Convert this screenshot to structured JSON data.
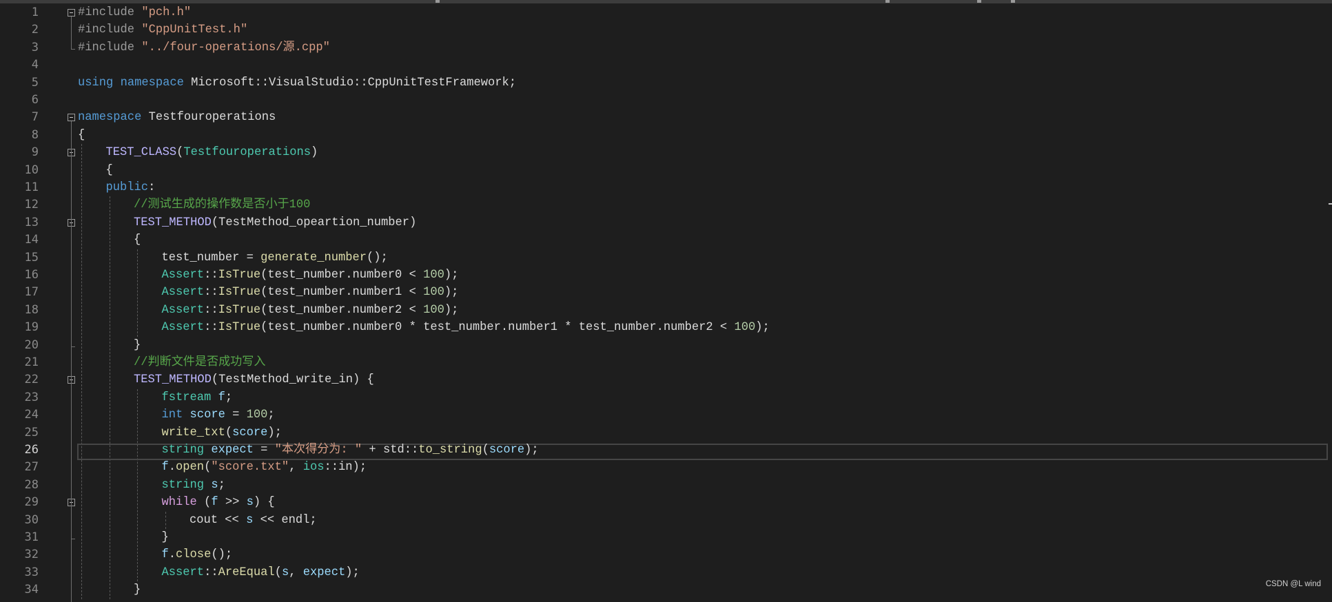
{
  "editor": {
    "active_line": 26,
    "watermark": "CSDN @L wind",
    "lines": [
      {
        "n": "1",
        "indent": 0,
        "tokens": [
          {
            "t": "#include ",
            "c": "pp"
          },
          {
            "t": "\"pch.h\"",
            "c": "str"
          }
        ]
      },
      {
        "n": "2",
        "indent": 0,
        "tokens": [
          {
            "t": "#include ",
            "c": "pp"
          },
          {
            "t": "\"CppUnitTest.h\"",
            "c": "str"
          }
        ]
      },
      {
        "n": "3",
        "indent": 0,
        "tokens": [
          {
            "t": "#include ",
            "c": "pp"
          },
          {
            "t": "\"../four-operations/源.cpp\"",
            "c": "str"
          }
        ]
      },
      {
        "n": "4",
        "indent": 0,
        "tokens": []
      },
      {
        "n": "5",
        "indent": 0,
        "tokens": [
          {
            "t": "using",
            "c": "kw"
          },
          {
            "t": " ",
            "c": "id"
          },
          {
            "t": "namespace",
            "c": "kw"
          },
          {
            "t": " Microsoft::VisualStudio::CppUnitTestFramework;",
            "c": "id"
          }
        ]
      },
      {
        "n": "6",
        "indent": 0,
        "tokens": []
      },
      {
        "n": "7",
        "indent": 0,
        "tokens": [
          {
            "t": "namespace",
            "c": "kw"
          },
          {
            "t": " Testfouroperations",
            "c": "id"
          }
        ]
      },
      {
        "n": "8",
        "indent": 0,
        "tokens": [
          {
            "t": "{",
            "c": "id"
          }
        ]
      },
      {
        "n": "9",
        "indent": 1,
        "tokens": [
          {
            "t": "TEST_CLASS",
            "c": "mac"
          },
          {
            "t": "(",
            "c": "id"
          },
          {
            "t": "Testfouroperations",
            "c": "ty"
          },
          {
            "t": ")",
            "c": "id"
          }
        ]
      },
      {
        "n": "10",
        "indent": 1,
        "tokens": [
          {
            "t": "{",
            "c": "id"
          }
        ]
      },
      {
        "n": "11",
        "indent": 1,
        "tokens": [
          {
            "t": "public",
            "c": "kw"
          },
          {
            "t": ":",
            "c": "id"
          }
        ]
      },
      {
        "n": "12",
        "indent": 2,
        "tokens": [
          {
            "t": "//测试生成的操作数是否小于100",
            "c": "cm"
          }
        ]
      },
      {
        "n": "13",
        "indent": 2,
        "tokens": [
          {
            "t": "TEST_METHOD",
            "c": "mac"
          },
          {
            "t": "(TestMethod_opeartion_number)",
            "c": "id"
          }
        ]
      },
      {
        "n": "14",
        "indent": 2,
        "tokens": [
          {
            "t": "{",
            "c": "id"
          }
        ]
      },
      {
        "n": "15",
        "indent": 3,
        "tokens": [
          {
            "t": "test_number = ",
            "c": "id"
          },
          {
            "t": "generate_number",
            "c": "fn"
          },
          {
            "t": "();",
            "c": "id"
          }
        ]
      },
      {
        "n": "16",
        "indent": 3,
        "tokens": [
          {
            "t": "Assert",
            "c": "ty"
          },
          {
            "t": "::",
            "c": "id"
          },
          {
            "t": "IsTrue",
            "c": "fn"
          },
          {
            "t": "(test_number.number0 < ",
            "c": "id"
          },
          {
            "t": "100",
            "c": "num"
          },
          {
            "t": ");",
            "c": "id"
          }
        ]
      },
      {
        "n": "17",
        "indent": 3,
        "tokens": [
          {
            "t": "Assert",
            "c": "ty"
          },
          {
            "t": "::",
            "c": "id"
          },
          {
            "t": "IsTrue",
            "c": "fn"
          },
          {
            "t": "(test_number.number1 < ",
            "c": "id"
          },
          {
            "t": "100",
            "c": "num"
          },
          {
            "t": ");",
            "c": "id"
          }
        ]
      },
      {
        "n": "18",
        "indent": 3,
        "tokens": [
          {
            "t": "Assert",
            "c": "ty"
          },
          {
            "t": "::",
            "c": "id"
          },
          {
            "t": "IsTrue",
            "c": "fn"
          },
          {
            "t": "(test_number.number2 < ",
            "c": "id"
          },
          {
            "t": "100",
            "c": "num"
          },
          {
            "t": ");",
            "c": "id"
          }
        ]
      },
      {
        "n": "19",
        "indent": 3,
        "tokens": [
          {
            "t": "Assert",
            "c": "ty"
          },
          {
            "t": "::",
            "c": "id"
          },
          {
            "t": "IsTrue",
            "c": "fn"
          },
          {
            "t": "(test_number.number0 * test_number.number1 * test_number.number2 < ",
            "c": "id"
          },
          {
            "t": "100",
            "c": "num"
          },
          {
            "t": ");",
            "c": "id"
          }
        ]
      },
      {
        "n": "20",
        "indent": 2,
        "tokens": [
          {
            "t": "}",
            "c": "id"
          }
        ]
      },
      {
        "n": "21",
        "indent": 2,
        "tokens": [
          {
            "t": "//判断文件是否成功写入",
            "c": "cm"
          }
        ]
      },
      {
        "n": "22",
        "indent": 2,
        "tokens": [
          {
            "t": "TEST_METHOD",
            "c": "mac"
          },
          {
            "t": "(TestMethod_write_in) {",
            "c": "id"
          }
        ]
      },
      {
        "n": "23",
        "indent": 3,
        "tokens": [
          {
            "t": "fstream",
            "c": "ty"
          },
          {
            "t": " ",
            "c": "id"
          },
          {
            "t": "f",
            "c": "var"
          },
          {
            "t": ";",
            "c": "id"
          }
        ]
      },
      {
        "n": "24",
        "indent": 3,
        "tokens": [
          {
            "t": "int",
            "c": "kw"
          },
          {
            "t": " ",
            "c": "id"
          },
          {
            "t": "score",
            "c": "var"
          },
          {
            "t": " = ",
            "c": "id"
          },
          {
            "t": "100",
            "c": "num"
          },
          {
            "t": ";",
            "c": "id"
          }
        ]
      },
      {
        "n": "25",
        "indent": 3,
        "tokens": [
          {
            "t": "write_txt",
            "c": "fn"
          },
          {
            "t": "(",
            "c": "id"
          },
          {
            "t": "score",
            "c": "var"
          },
          {
            "t": ");",
            "c": "id"
          }
        ]
      },
      {
        "n": "26",
        "indent": 3,
        "tokens": [
          {
            "t": "string",
            "c": "ty"
          },
          {
            "t": " ",
            "c": "id"
          },
          {
            "t": "expect",
            "c": "var"
          },
          {
            "t": " = ",
            "c": "id"
          },
          {
            "t": "\"本次得分为: \"",
            "c": "str"
          },
          {
            "t": " + std::",
            "c": "id"
          },
          {
            "t": "to_string",
            "c": "fn"
          },
          {
            "t": "(",
            "c": "id"
          },
          {
            "t": "score",
            "c": "var"
          },
          {
            "t": ");",
            "c": "id"
          }
        ]
      },
      {
        "n": "27",
        "indent": 3,
        "tokens": [
          {
            "t": "f",
            "c": "var"
          },
          {
            "t": ".",
            "c": "id"
          },
          {
            "t": "open",
            "c": "fn"
          },
          {
            "t": "(",
            "c": "id"
          },
          {
            "t": "\"score.txt\"",
            "c": "str"
          },
          {
            "t": ", ",
            "c": "id"
          },
          {
            "t": "ios",
            "c": "ty"
          },
          {
            "t": "::in);",
            "c": "id"
          }
        ]
      },
      {
        "n": "28",
        "indent": 3,
        "tokens": [
          {
            "t": "string",
            "c": "ty"
          },
          {
            "t": " ",
            "c": "id"
          },
          {
            "t": "s",
            "c": "var"
          },
          {
            "t": ";",
            "c": "id"
          }
        ]
      },
      {
        "n": "29",
        "indent": 3,
        "tokens": [
          {
            "t": "while",
            "c": "ctl"
          },
          {
            "t": " (",
            "c": "id"
          },
          {
            "t": "f",
            "c": "var"
          },
          {
            "t": " >> ",
            "c": "id"
          },
          {
            "t": "s",
            "c": "var"
          },
          {
            "t": ") {",
            "c": "id"
          }
        ]
      },
      {
        "n": "30",
        "indent": 4,
        "tokens": [
          {
            "t": "cout << ",
            "c": "id"
          },
          {
            "t": "s",
            "c": "var"
          },
          {
            "t": " << endl;",
            "c": "id"
          }
        ]
      },
      {
        "n": "31",
        "indent": 3,
        "tokens": [
          {
            "t": "}",
            "c": "id"
          }
        ]
      },
      {
        "n": "32",
        "indent": 3,
        "tokens": [
          {
            "t": "f",
            "c": "var"
          },
          {
            "t": ".",
            "c": "id"
          },
          {
            "t": "close",
            "c": "fn"
          },
          {
            "t": "();",
            "c": "id"
          }
        ]
      },
      {
        "n": "33",
        "indent": 3,
        "tokens": [
          {
            "t": "Assert",
            "c": "ty"
          },
          {
            "t": "::",
            "c": "id"
          },
          {
            "t": "AreEqual",
            "c": "fn"
          },
          {
            "t": "(",
            "c": "id"
          },
          {
            "t": "s",
            "c": "var"
          },
          {
            "t": ", ",
            "c": "id"
          },
          {
            "t": "expect",
            "c": "var"
          },
          {
            "t": ");",
            "c": "id"
          }
        ]
      },
      {
        "n": "34",
        "indent": 2,
        "tokens": [
          {
            "t": "}",
            "c": "id"
          }
        ]
      }
    ]
  }
}
